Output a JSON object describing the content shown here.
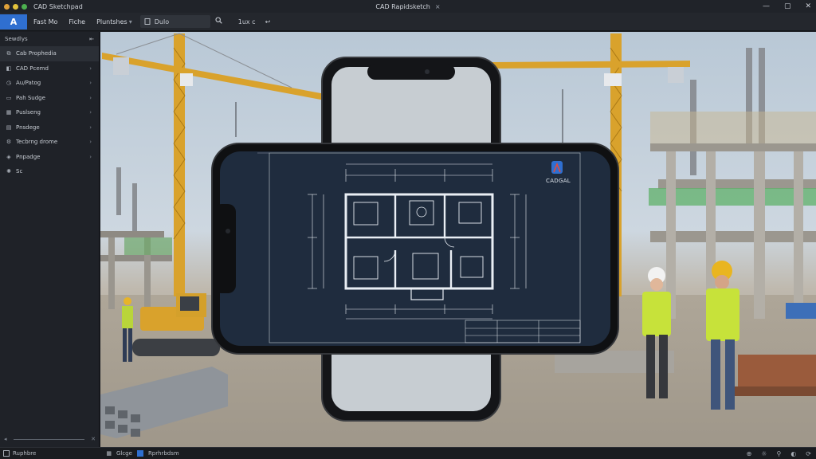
{
  "titlebar": {
    "app_name": "CAD Sketchpad",
    "window_title": "CAD Rapidsketch",
    "close_glyph": "×",
    "controls": [
      "—",
      "▢",
      "✕"
    ]
  },
  "toolbar": {
    "logo": "A",
    "menu": [
      "Fast Mo",
      "Fiche",
      "Pluntshes"
    ],
    "search_value": "Dulo",
    "zoom": "1ux c",
    "arrows": "↩"
  },
  "sidebar": {
    "header": "Sewdlys",
    "items": [
      {
        "label": "Cab Prophedia",
        "icon": "layers-icon"
      },
      {
        "label": "CAD Pcemd",
        "icon": "cube-icon"
      },
      {
        "label": "Au/Patog",
        "icon": "clock-icon"
      },
      {
        "label": "Pah Sudge",
        "icon": "folder-icon"
      },
      {
        "label": "Puslseng",
        "icon": "grid-icon"
      },
      {
        "label": "Pnsdege",
        "icon": "document-icon"
      },
      {
        "label": "Tecbrng drome",
        "icon": "settings-icon"
      },
      {
        "label": "Pnpadge",
        "icon": "tag-icon"
      },
      {
        "label": "Sc",
        "icon": "gear-icon"
      }
    ],
    "bottom_left": "◂",
    "bottom_right": "✕"
  },
  "plan": {
    "logo_text": "CADGAL"
  },
  "statusbar": {
    "left_label": "Ruphbre",
    "mid_labels": [
      "Glcge",
      "Rprhrbdsm"
    ],
    "right_icons": [
      "⊕",
      "☼",
      "⚲",
      "◐",
      "⟳"
    ]
  },
  "colors": {
    "accent": "#2f6fd0",
    "plan_bg": "#1f2c3e",
    "crane": "#d9a22c",
    "vest": "#c7e23a"
  }
}
